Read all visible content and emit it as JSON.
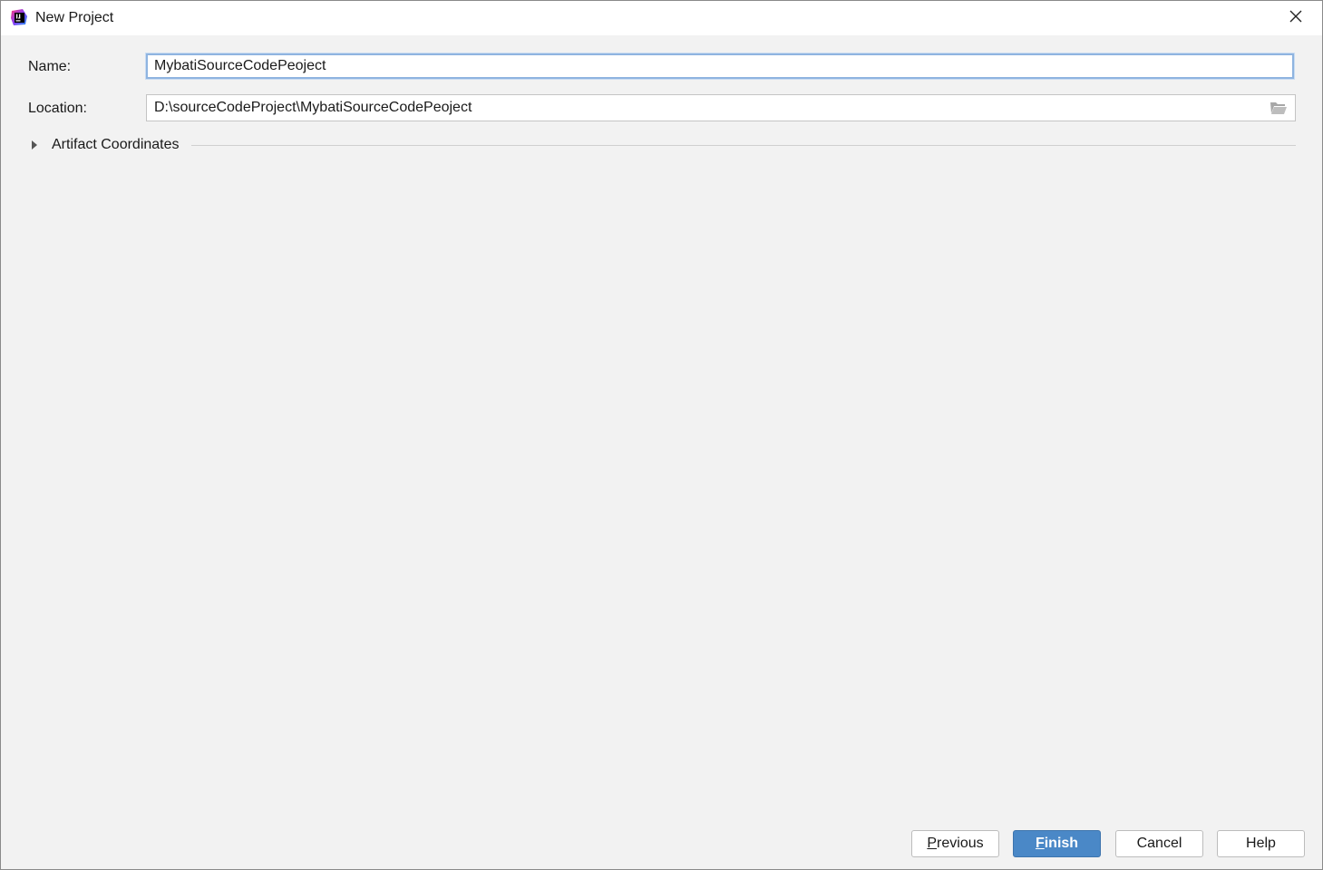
{
  "window": {
    "title": "New Project",
    "app_icon": "intellij-idea-icon",
    "close_icon": "close-icon"
  },
  "form": {
    "name_label": "Name:",
    "name_value": "MybatiSourceCodePeoject",
    "location_label": "Location:",
    "location_value": "D:\\sourceCodeProject\\MybatiSourceCodePeoject",
    "browse_icon": "folder-open-icon"
  },
  "artifact_section": {
    "label": "Artifact Coordinates",
    "expanded": false,
    "arrow_icon": "chevron-right-icon"
  },
  "buttons": {
    "previous": "Previous",
    "finish": "Finish",
    "cancel": "Cancel",
    "help": "Help"
  },
  "colors": {
    "primary_button": "#4a88c7",
    "focus_border": "#8fb4e0",
    "background": "#f2f2f2"
  }
}
